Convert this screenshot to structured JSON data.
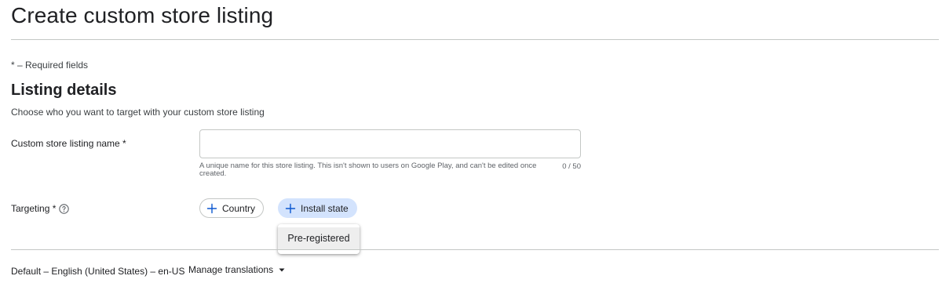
{
  "header": {
    "title": "Create custom store listing"
  },
  "form": {
    "required_note": "* – Required fields",
    "section_title": "Listing details",
    "section_description": "Choose who you want to target with your custom store listing",
    "name_field": {
      "label": "Custom store listing name  *",
      "value": "",
      "placeholder": "",
      "helper": "A unique name for this store listing. This isn't shown to users on Google Play, and can't be edited once created.",
      "char_count": "0 / 50"
    },
    "targeting": {
      "label": "Targeting *",
      "help_icon": "help-circle-icon",
      "chips": [
        {
          "label": "Country",
          "icon": "plus-icon",
          "selected": false
        },
        {
          "label": "Install state",
          "icon": "plus-icon",
          "selected": true
        }
      ],
      "menu_items": [
        {
          "label": "Pre-registered"
        }
      ]
    }
  },
  "footer": {
    "language": "Default – English (United States) – en-US",
    "manage_translations": "Manage translations",
    "manage_icon": "caret-down-icon"
  },
  "colors": {
    "accent": "#0b57d0",
    "chip_selected_bg": "#d3e3fd",
    "border": "#c4c7c5",
    "text_primary": "#202124",
    "text_secondary": "#5f6368"
  }
}
